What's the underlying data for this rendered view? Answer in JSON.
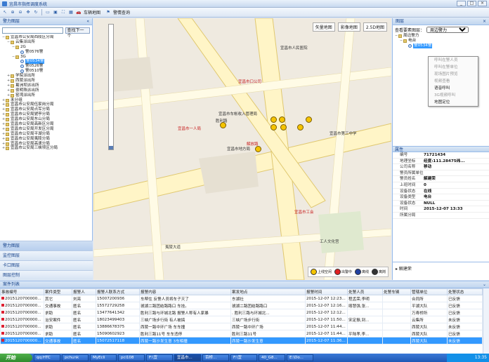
{
  "window": {
    "title": "宜昌市指挥调度系统",
    "buttons": [
      "_",
      "□",
      "×"
    ]
  },
  "toolbar": {
    "items": [
      "车辆地图",
      "警情查询"
    ]
  },
  "left_panel": {
    "title": "警力图层",
    "search_placeholder": "",
    "find_next": "查找下一个",
    "tree": [
      {
        "indent": 0,
        "twisty": "−",
        "icon": "folder",
        "label": "宜昌市公安局西陵区分局"
      },
      {
        "indent": 1,
        "twisty": "−",
        "icon": "folder",
        "label": "云集派出所"
      },
      {
        "indent": 2,
        "twisty": "−",
        "icon": "folder",
        "label": "2G"
      },
      {
        "indent": 3,
        "twisty": "",
        "icon": "radio",
        "label": "警0576警"
      },
      {
        "indent": 2,
        "twisty": "−",
        "icon": "folder",
        "label": "3G"
      },
      {
        "indent": 3,
        "twisty": "",
        "icon": "radio",
        "label": "警0534警",
        "selected": true
      },
      {
        "indent": 3,
        "twisty": "",
        "icon": "radio",
        "label": "警0526警"
      },
      {
        "indent": 3,
        "twisty": "",
        "icon": "radio",
        "label": "警0510警"
      },
      {
        "indent": 1,
        "twisty": "+",
        "icon": "folder",
        "label": "学院派出所"
      },
      {
        "indent": 1,
        "twisty": "+",
        "icon": "folder",
        "label": "西陵派出所"
      },
      {
        "indent": 1,
        "twisty": "+",
        "icon": "folder",
        "label": "葛洲坝派出所"
      },
      {
        "indent": 1,
        "twisty": "+",
        "icon": "folder",
        "label": "夜明珠派出所"
      },
      {
        "indent": 1,
        "twisty": "+",
        "icon": "folder",
        "label": "窑湾派出所"
      },
      {
        "indent": 0,
        "twisty": "+",
        "icon": "folder",
        "label": "未分组"
      },
      {
        "indent": 0,
        "twisty": "+",
        "icon": "folder",
        "label": "宜昌市公安局伍家岗分局"
      },
      {
        "indent": 0,
        "twisty": "+",
        "icon": "folder",
        "label": "宜昌市公安局点军分局"
      },
      {
        "indent": 0,
        "twisty": "+",
        "icon": "folder",
        "label": "宜昌市公安局猇亭分局"
      },
      {
        "indent": 0,
        "twisty": "+",
        "icon": "folder",
        "label": "宜昌市公安局东山分局"
      },
      {
        "indent": 0,
        "twisty": "+",
        "icon": "folder",
        "label": "宜昌市公安局高新区分局"
      },
      {
        "indent": 0,
        "twisty": "+",
        "icon": "folder",
        "label": "宜昌市公安局开发区分局"
      },
      {
        "indent": 0,
        "twisty": "+",
        "icon": "folder",
        "label": "宜昌市公安局平湖分局"
      },
      {
        "indent": 0,
        "twisty": "+",
        "icon": "folder",
        "label": "宜昌市公安局夷陵分局"
      },
      {
        "indent": 0,
        "twisty": "+",
        "icon": "folder",
        "label": "宜昌市公安局高速分局"
      },
      {
        "indent": 0,
        "twisty": "+",
        "icon": "folder",
        "label": "宜昌市公安局三峡坝区分局"
      }
    ],
    "nav": [
      "警力图层",
      "监控图层",
      "卡口图层",
      "图层控制"
    ]
  },
  "map": {
    "types": [
      "矢量地图",
      "影像地图",
      "2.5D地图"
    ],
    "labels": [
      {
        "text": "宜昌市车帐收入管理局",
        "red": false
      },
      {
        "text": "宜昌市一人局",
        "red": true
      },
      {
        "text": "宜昌市地方局",
        "red": false
      },
      {
        "text": "解放路",
        "red": true
      },
      {
        "text": "胜利路",
        "red": false
      },
      {
        "text": "宜昌市口公司",
        "red": true
      },
      {
        "text": "宜昌市工会",
        "red": true
      },
      {
        "text": "工人文化宫",
        "red": false
      },
      {
        "text": "夷陵大道",
        "red": false
      },
      {
        "text": "宜昌市人民医院",
        "red": false
      },
      {
        "text": "宜昌市第三中学",
        "red": false
      }
    ],
    "legend": [
      {
        "label": "上线空闲",
        "color": "#f5c400"
      },
      {
        "label": "出警中",
        "color": "#e02020"
      },
      {
        "label": "离线",
        "color": "#2040a0"
      },
      {
        "label": "离岗",
        "color": "#333333"
      }
    ]
  },
  "right_panel": {
    "title": "图层",
    "layer_select_label": "查看要素图层：",
    "layer_select_value": "周边警力",
    "layer_tree": [
      "周边警力",
      "电台",
      "警0534警"
    ],
    "context_menu": [
      {
        "label": "呼叫在警人员",
        "disabled": true
      },
      {
        "label": "呼叫在警单位",
        "disabled": true
      },
      {
        "label": "现场图片预览",
        "disabled": true
      },
      {
        "label": "视频查看",
        "disabled": true
      },
      {
        "label": "语音呼叫",
        "disabled": false
      },
      {
        "label": "3G视频呼叫",
        "disabled": true
      },
      {
        "label": "地图定位",
        "disabled": false
      }
    ],
    "props_title": "属性",
    "props": [
      {
        "k": "编号",
        "v": "71721434"
      },
      {
        "k": "地理坐标",
        "v": "经度:111.28475纬..."
      },
      {
        "k": "公司名称",
        "v": "移动"
      },
      {
        "k": "警员所属单位",
        "v": ""
      },
      {
        "k": "警员姓名",
        "v": "解建荣"
      },
      {
        "k": "上班时间",
        "v": "0"
      },
      {
        "k": "设备状态",
        "v": "在线"
      },
      {
        "k": "设备类型",
        "v": "电台"
      },
      {
        "k": "设备状态",
        "v": "NULL"
      },
      {
        "k": "时间",
        "v": "2015-12-07 13:33"
      },
      {
        "k": "所属分局",
        "v": ""
      }
    ],
    "desc_label": "解建荣"
  },
  "grid": {
    "title": "案件列表",
    "columns": [
      "事故编号",
      "案件类型",
      "报警人",
      "报警人联系方式",
      "报警内容",
      "案发地点",
      "报警时间",
      "处警人员",
      "处警车辆",
      "管辖单位",
      "处警状态"
    ],
    "rows": [
      {
        "sel": false,
        "flag": true,
        "cells": [
          "2015120700000...",
          "其它",
          "刘亮",
          "15007200936",
          "车帮住 反警人员将车子灭了",
          "东湖社",
          "2015-12-07 12:23...",
          "程孟荣,李明",
          "",
          "合同所",
          "已反馈"
        ]
      },
      {
        "sel": false,
        "flag": true,
        "cells": [
          "2015120700000...",
          "交通事故",
          "匿名",
          "15572729258",
          "琥湖二路团结路路口 车挂。",
          "琥湖二路团结路路口",
          "2015-12-07 12:16...",
          "喀慧强,张...",
          "",
          "平湖大队",
          "已反馈"
        ]
      },
      {
        "sel": false,
        "flag": true,
        "cells": [
          "2015120700000...",
          "求助",
          "匿名",
          "13477641342",
          "胜利三路与环城北路 报警人称有人家暴",
          ". 胜利三路与环城北...",
          "2015-12-07 12:12...",
          "",
          "",
          "万寿桥所",
          "已反馈"
        ]
      },
      {
        "sel": false,
        "flag": true,
        "cells": [
          "2015120700000...",
          "治安案件",
          "匿名",
          "18023499403",
          "三峡广场步行街 有人被搞",
          "三峡广场步行街",
          "2015-12-07 11:50...",
          "宋定振,到...",
          "",
          "云集所",
          "未反馈"
        ]
      },
      {
        "sel": false,
        "flag": true,
        "cells": [
          "2015120700000...",
          "求助",
          "匿名",
          "13886678375",
          "西陵一路中环广场 车车撞",
          "西陵一路中环广场",
          "2015-12-07 11:44...",
          "",
          "",
          "西陵大队",
          "未反馈"
        ]
      },
      {
        "sel": false,
        "flag": true,
        "cells": [
          "2015120700000...",
          "求助",
          "匿名",
          "15090602923",
          "胜利三路11号 车车违停",
          "胜利三路11号",
          "2015-12-07 11:44...",
          "平陆孝,李...",
          "",
          "西陵大队",
          "已反馈"
        ]
      },
      {
        "sel": true,
        "flag": true,
        "cells": [
          "2015120700000...",
          "交通事故",
          "匿名",
          "15072517118",
          "西陵一路沙发生意 3车相撞",
          "西陵一路沙发生意",
          "2015-12-07 11:36...",
          "",
          "",
          "西陵大队",
          "未反馈"
        ]
      }
    ]
  },
  "taskbar": {
    "start": "开始",
    "tasks": [
      "qq:HTC",
      "pchunk",
      "MyEcli",
      "pci108",
      "F:\\宜",
      "百桥...",
      "F:\\宜",
      "40_G8...",
      "E:\\Do..."
    ],
    "active_task": "宜昌市...",
    "time": "13:35"
  }
}
